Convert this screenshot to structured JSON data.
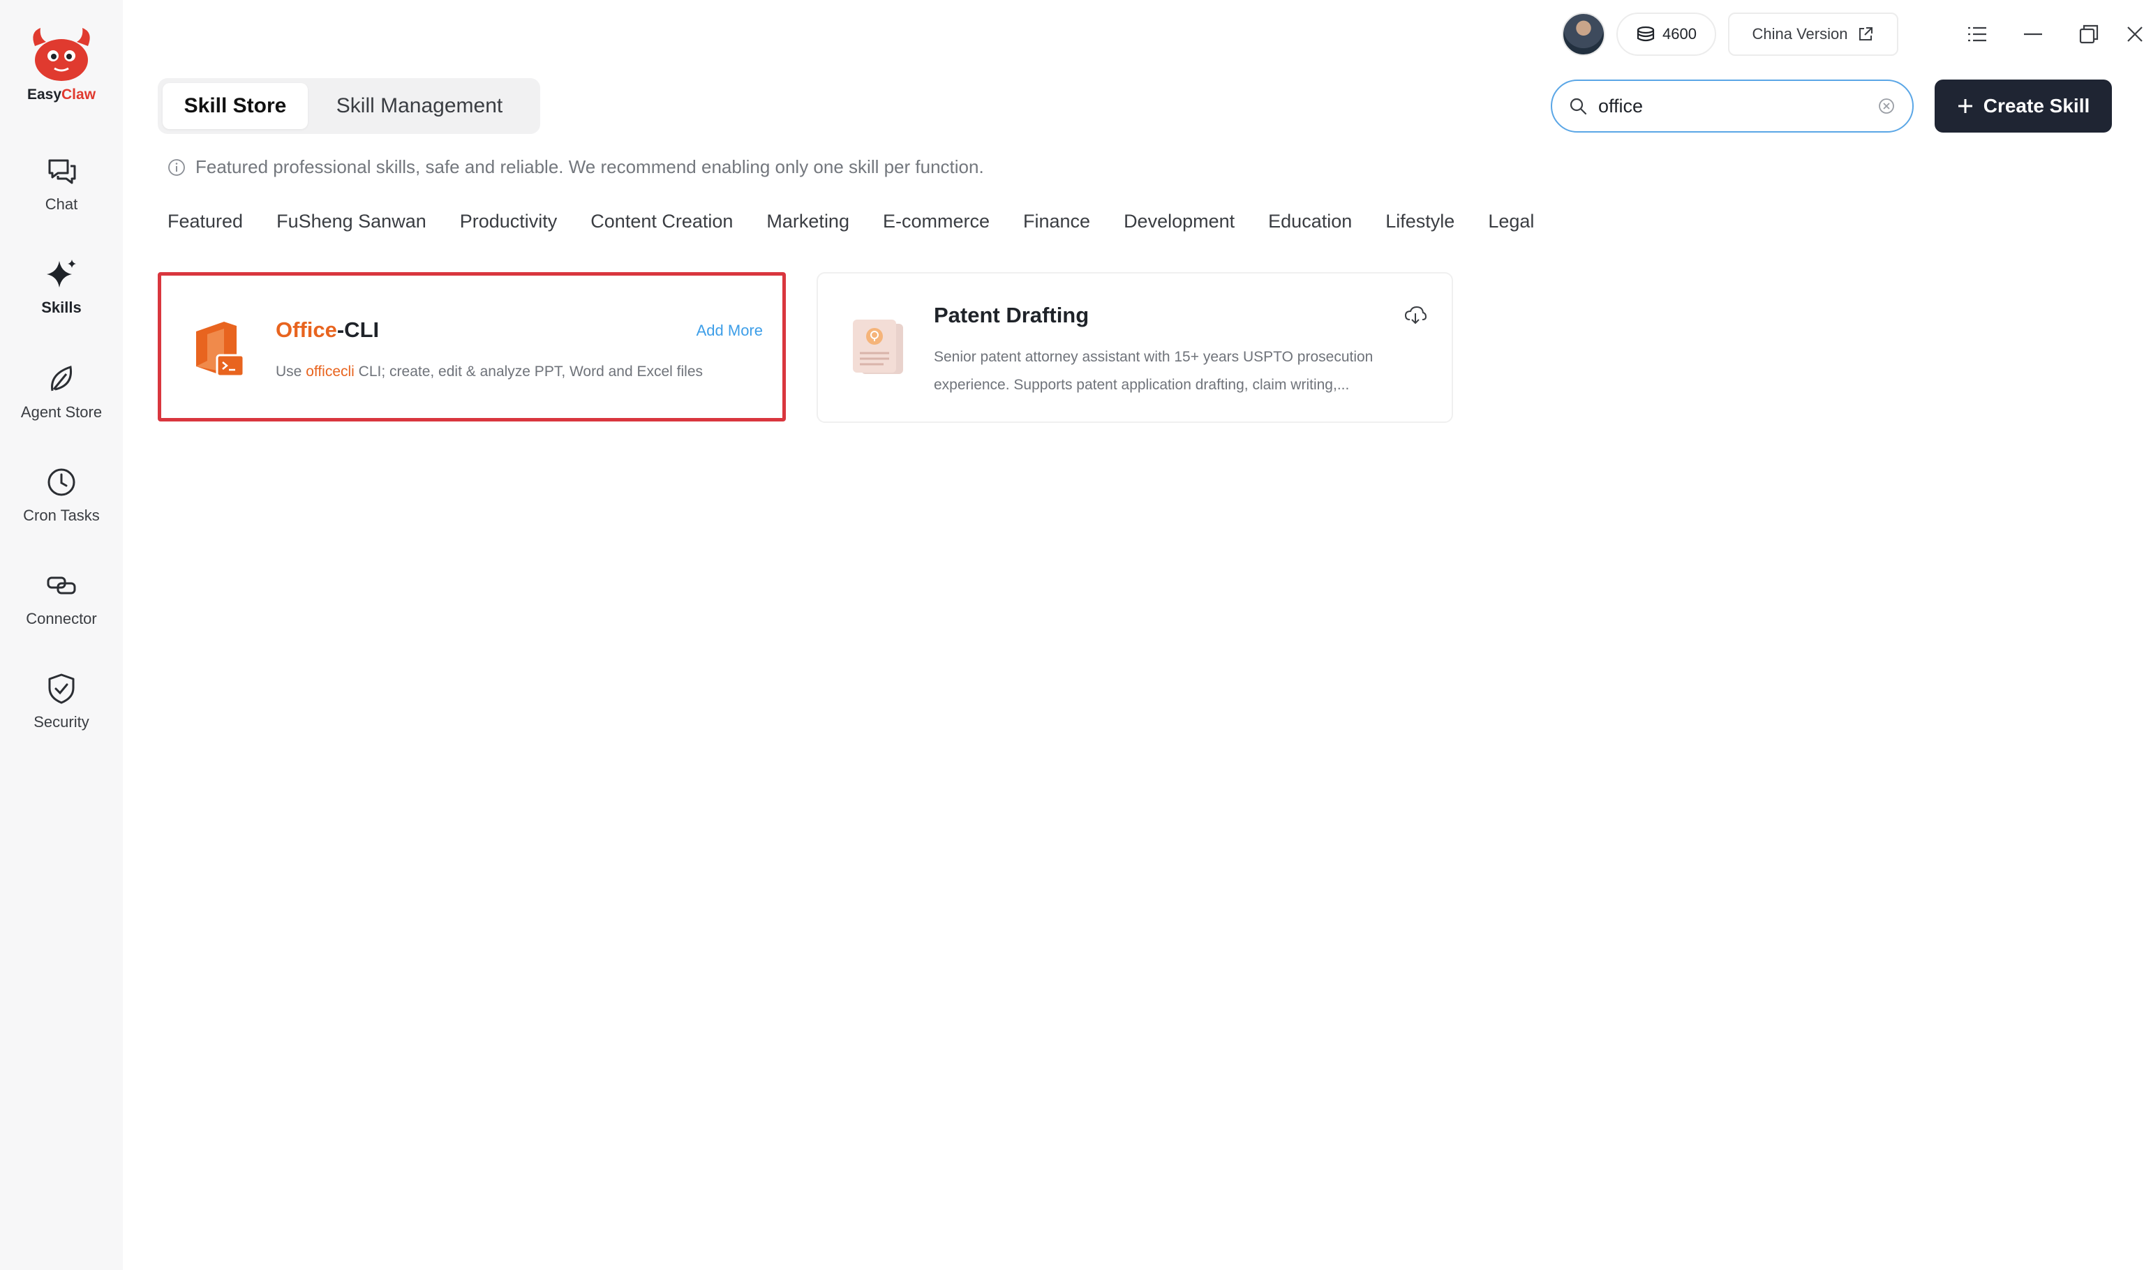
{
  "app": {
    "logo_easy": "Easy",
    "logo_claw": "Claw"
  },
  "sidebar": {
    "items": [
      {
        "label": "Chat",
        "icon": "chat-icon",
        "active": false
      },
      {
        "label": "Skills",
        "icon": "sparkle-icon",
        "active": true
      },
      {
        "label": "Agent Store",
        "icon": "leaf-icon",
        "active": false
      },
      {
        "label": "Cron Tasks",
        "icon": "clock-icon",
        "active": false
      },
      {
        "label": "Connector",
        "icon": "link-icon",
        "active": false
      },
      {
        "label": "Security",
        "icon": "shield-icon",
        "active": false
      }
    ]
  },
  "topbar": {
    "credits": "4600",
    "china_version": "China Version"
  },
  "tabs": [
    {
      "label": "Skill Store",
      "active": true
    },
    {
      "label": "Skill Management",
      "active": false
    }
  ],
  "search": {
    "value": "office"
  },
  "create_button": "Create Skill",
  "info_text": "Featured professional skills, safe and reliable. We recommend enabling only one skill per function.",
  "categories": [
    "Featured",
    "FuSheng Sanwan",
    "Productivity",
    "Content Creation",
    "Marketing",
    "E-commerce",
    "Finance",
    "Development",
    "Education",
    "Lifestyle",
    "Legal"
  ],
  "cards": [
    {
      "title_highlight": "Office",
      "title_rest": "-CLI",
      "action": "Add More",
      "desc_pre": "Use ",
      "desc_highlight": "officecli",
      "desc_post": " CLI; create, edit & analyze PPT, Word and Excel files",
      "icon": "office-icon"
    },
    {
      "title": "Patent Drafting",
      "desc": "Senior patent attorney assistant with 15+ years USPTO prosecution experience. Supports patent application drafting, claim writing,...",
      "icon": "patent-document-icon",
      "action_icon": "cloud-download-icon"
    }
  ],
  "colors": {
    "highlight": "#e8641f",
    "accent_blue": "#3d9ee8",
    "selection_border": "#d9363e",
    "primary_dark": "#1f2533",
    "logo_red": "#e03a2f"
  }
}
